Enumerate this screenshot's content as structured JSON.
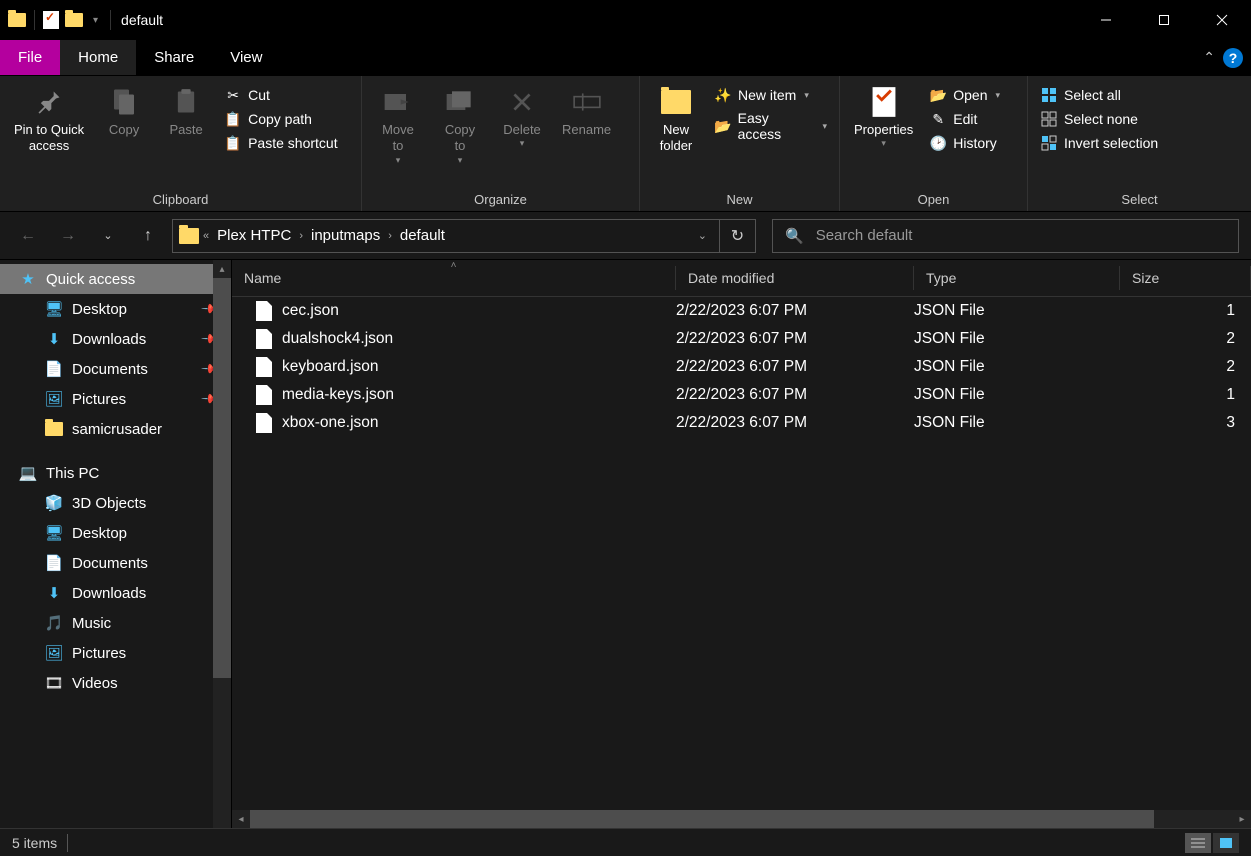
{
  "window": {
    "title": "default"
  },
  "tabs": {
    "file": "File",
    "home": "Home",
    "share": "Share",
    "view": "View"
  },
  "ribbon": {
    "clipboard": {
      "label": "Clipboard",
      "pin": "Pin to Quick\naccess",
      "copy": "Copy",
      "paste": "Paste",
      "cut": "Cut",
      "copy_path": "Copy path",
      "paste_shortcut": "Paste shortcut"
    },
    "organize": {
      "label": "Organize",
      "move_to": "Move\nto",
      "copy_to": "Copy\nto",
      "delete": "Delete",
      "rename": "Rename"
    },
    "new": {
      "label": "New",
      "new_folder": "New\nfolder",
      "new_item": "New item",
      "easy_access": "Easy access"
    },
    "open": {
      "label": "Open",
      "properties": "Properties",
      "open": "Open",
      "edit": "Edit",
      "history": "History"
    },
    "select": {
      "label": "Select",
      "select_all": "Select all",
      "select_none": "Select none",
      "invert": "Invert selection"
    }
  },
  "breadcrumb": {
    "items": [
      "Plex HTPC",
      "inputmaps",
      "default"
    ]
  },
  "search": {
    "placeholder": "Search default"
  },
  "sidebar": {
    "quick_access": "Quick access",
    "desktop": "Desktop",
    "downloads": "Downloads",
    "documents": "Documents",
    "pictures": "Pictures",
    "samicrusader": "samicrusader",
    "this_pc": "This PC",
    "objects3d": "3D Objects",
    "music": "Music",
    "videos": "Videos"
  },
  "columns": {
    "name": "Name",
    "date": "Date modified",
    "type": "Type",
    "size": "Size"
  },
  "files": [
    {
      "name": "cec.json",
      "date": "2/22/2023 6:07 PM",
      "type": "JSON File",
      "size": "1"
    },
    {
      "name": "dualshock4.json",
      "date": "2/22/2023 6:07 PM",
      "type": "JSON File",
      "size": "2"
    },
    {
      "name": "keyboard.json",
      "date": "2/22/2023 6:07 PM",
      "type": "JSON File",
      "size": "2"
    },
    {
      "name": "media-keys.json",
      "date": "2/22/2023 6:07 PM",
      "type": "JSON File",
      "size": "1"
    },
    {
      "name": "xbox-one.json",
      "date": "2/22/2023 6:07 PM",
      "type": "JSON File",
      "size": "3"
    }
  ],
  "status": {
    "count": "5 items"
  }
}
